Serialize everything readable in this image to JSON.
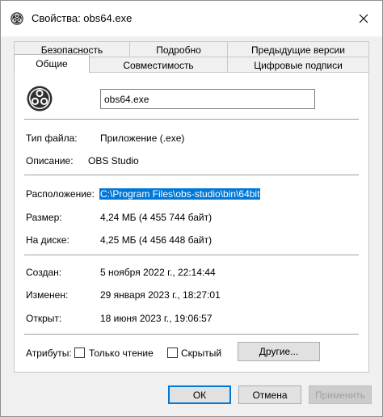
{
  "window": {
    "title": "Свойства: obs64.exe"
  },
  "tabs": {
    "row_back": [
      "Безопасность",
      "Подробно",
      "Предыдущие версии"
    ],
    "row_front": [
      "Общие",
      "Совместимость",
      "Цифровые подписи"
    ],
    "active": "Общие"
  },
  "general": {
    "file_name": "obs64.exe",
    "file_type_label": "Тип файла:",
    "file_type_value": "Приложение (.exe)",
    "description_label": "Описание:",
    "description_value": "OBS Studio",
    "location_label": "Расположение:",
    "location_value": "C:\\Program Files\\obs-studio\\bin\\64bit",
    "size_label": "Размер:",
    "size_value": "4,24 МБ (4 455 744 байт)",
    "disk_label": "На диске:",
    "disk_value": "4,25 МБ (4 456 448 байт)",
    "created_label": "Создан:",
    "created_value": "5 ноября 2022 г., 22:14:44",
    "modified_label": "Изменен:",
    "modified_value": "29 января 2023 г., 18:27:01",
    "opened_label": "Открыт:",
    "opened_value": "18 июня 2023 г., 19:06:57",
    "attributes_label": "Атрибуты:",
    "readonly_label": "Только чтение",
    "readonly_checked": false,
    "hidden_label": "Скрытый",
    "hidden_checked": false,
    "other_button": "Другие..."
  },
  "footer": {
    "ok": "ОК",
    "cancel": "Отмена",
    "apply": "Применить"
  },
  "colors": {
    "selection": "#0078d7",
    "window_bg": "#f0f0f0",
    "panel_bg": "#ffffff"
  },
  "icons": {
    "title": "obs-logo-icon",
    "close": "close-icon",
    "app": "obs-logo-icon"
  }
}
